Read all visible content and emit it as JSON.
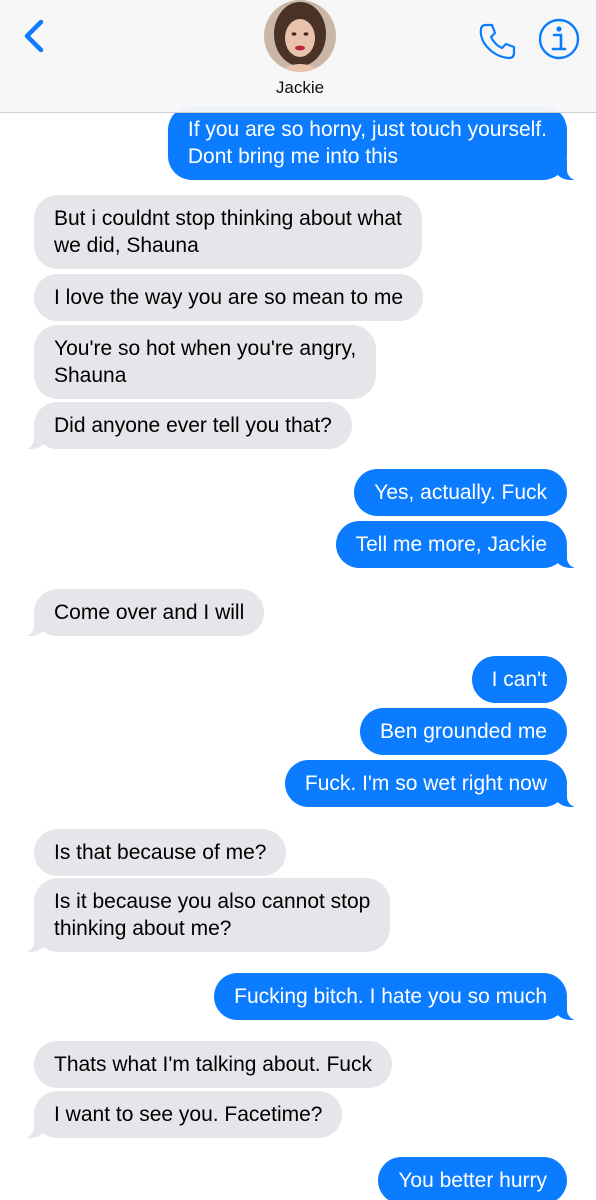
{
  "header": {
    "contact_name": "Jackie",
    "back_icon": "chevron-left-icon",
    "phone_icon": "phone-icon",
    "info_icon": "info-icon",
    "accent_color": "#0b7cff"
  },
  "colors": {
    "incoming_bubble": "#e5e5ea",
    "outgoing_bubble": "#0b7cff"
  },
  "messages": [
    {
      "from": "me",
      "lines": [
        "If you are so horny, just touch yourself.",
        "Dont bring me into this"
      ]
    },
    {
      "from": "contact",
      "lines": [
        "But i couldnt stop thinking about what",
        "we did, Shauna"
      ]
    },
    {
      "from": "contact",
      "lines": [
        "I love the way you are so mean to me"
      ]
    },
    {
      "from": "contact",
      "lines": [
        "You're so hot when you're angry,",
        "Shauna"
      ]
    },
    {
      "from": "contact",
      "lines": [
        "Did anyone ever tell you that?"
      ]
    },
    {
      "from": "me",
      "lines": [
        "Yes, actually. Fuck"
      ]
    },
    {
      "from": "me",
      "lines": [
        "Tell me more, Jackie"
      ]
    },
    {
      "from": "contact",
      "lines": [
        "Come over and I will"
      ]
    },
    {
      "from": "me",
      "lines": [
        "I can't"
      ]
    },
    {
      "from": "me",
      "lines": [
        "Ben grounded me"
      ]
    },
    {
      "from": "me",
      "lines": [
        "Fuck. I'm so wet right now"
      ]
    },
    {
      "from": "contact",
      "lines": [
        "Is that because of me?"
      ]
    },
    {
      "from": "contact",
      "lines": [
        "Is it because you also cannot stop",
        "thinking about me?"
      ]
    },
    {
      "from": "me",
      "lines": [
        "Fucking bitch. I hate you so much"
      ]
    },
    {
      "from": "contact",
      "lines": [
        "Thats what I'm talking about. Fuck"
      ]
    },
    {
      "from": "contact",
      "lines": [
        "I want to see you. Facetime?"
      ]
    },
    {
      "from": "me",
      "lines": [
        "You better hurry"
      ]
    }
  ]
}
